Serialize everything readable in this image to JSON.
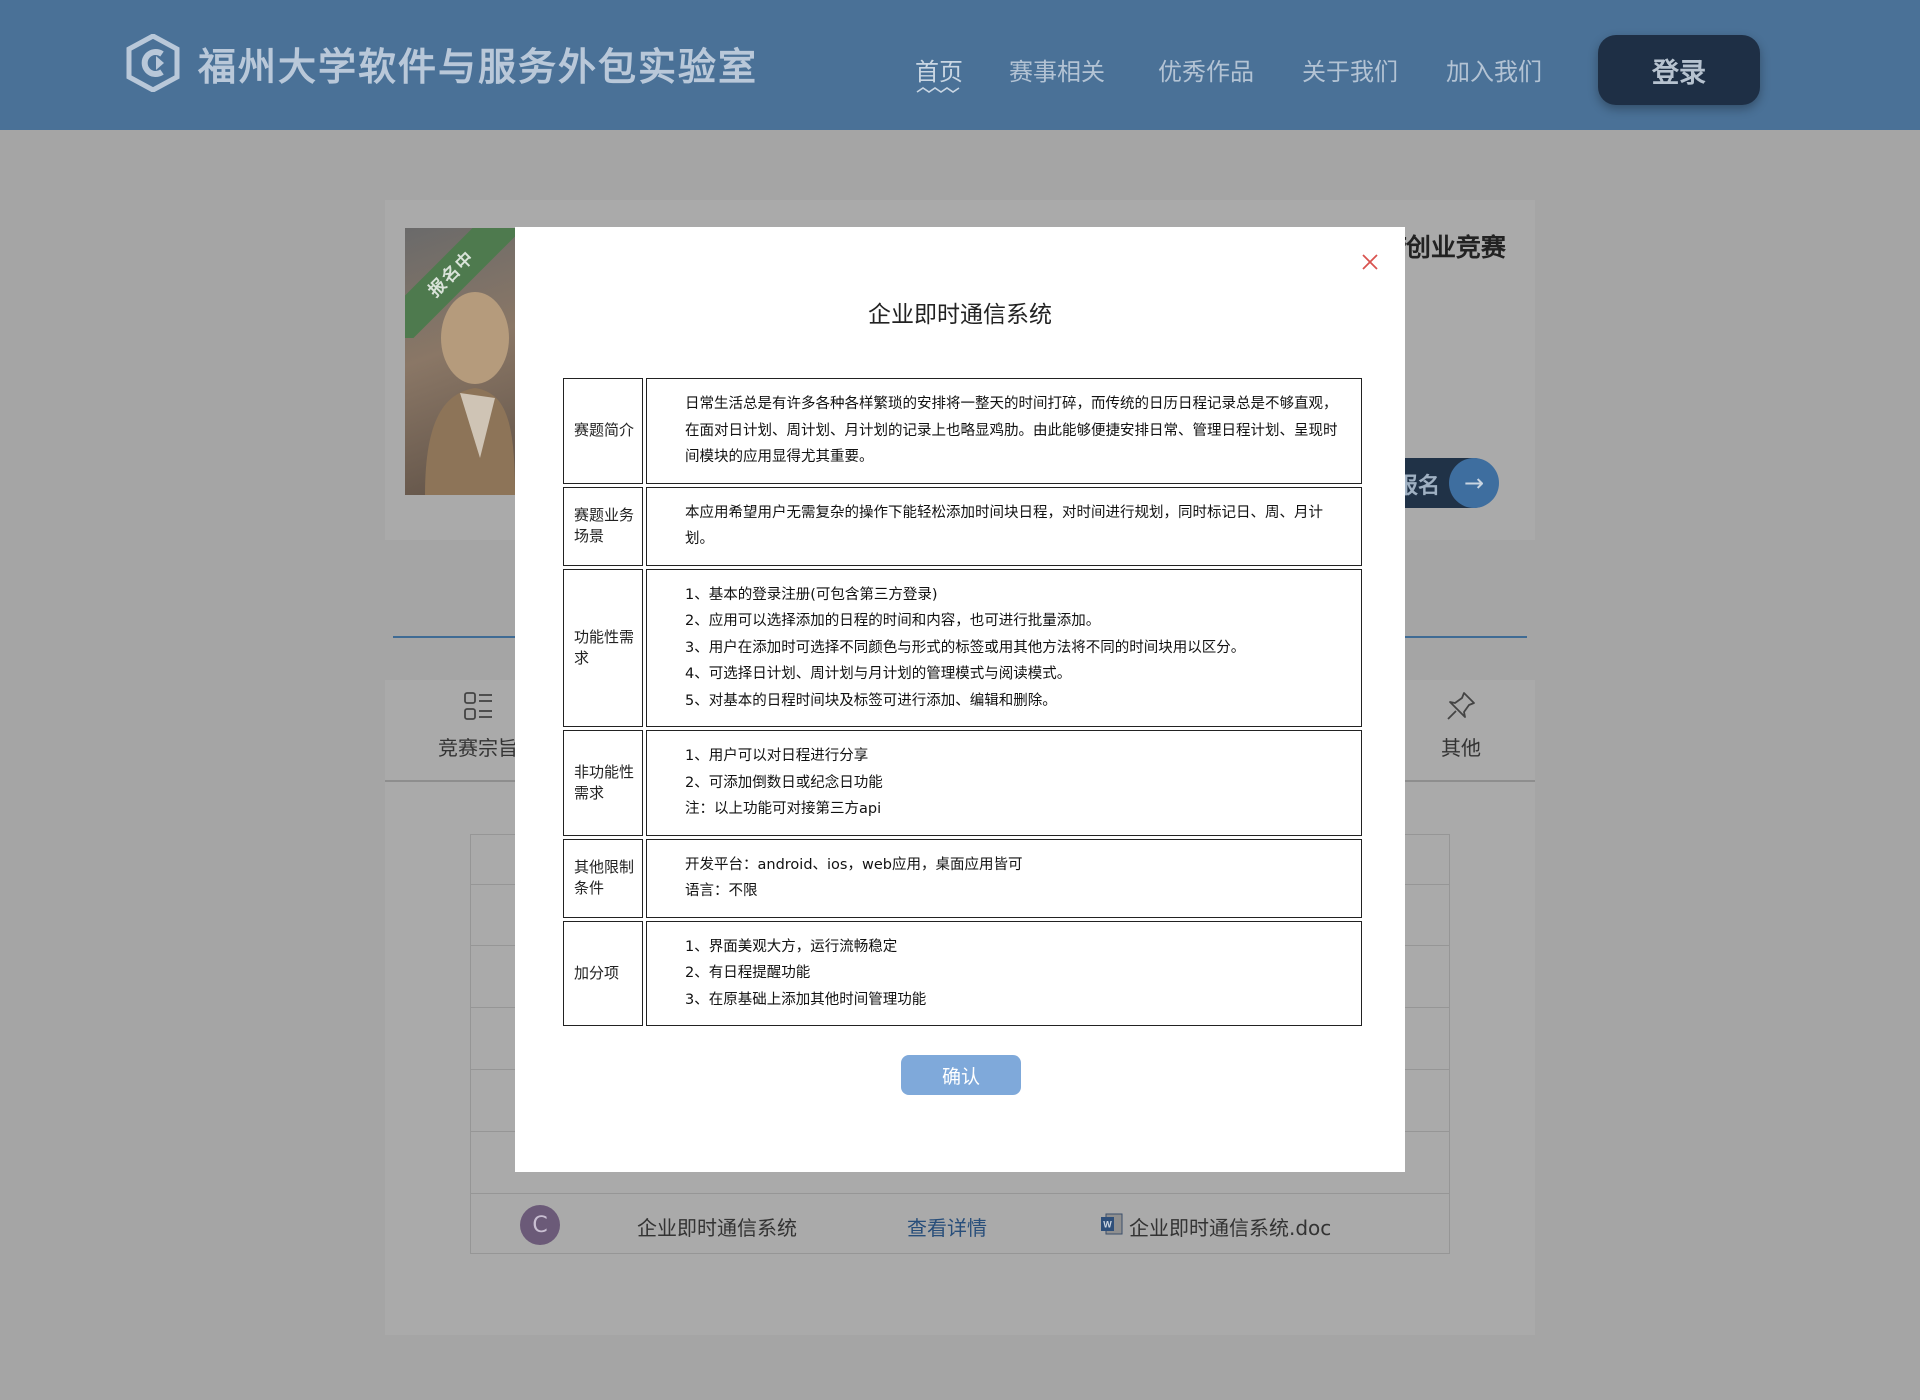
{
  "header": {
    "site_title": "福州大学软件与服务外包实验室",
    "nav": [
      "首页",
      "赛事相关",
      "优秀作品",
      "关于我们",
      "加入我们"
    ],
    "active_nav": "首页",
    "login_label": "登录"
  },
  "background": {
    "ribbon_label": "报名中",
    "contest_name_partial": "f创业竞赛",
    "signup_partial": "报名",
    "tabs": [
      {
        "label": "竞赛宗旨",
        "icon": "list-grid-icon"
      },
      {
        "label": "其他",
        "icon": "pin-icon"
      }
    ],
    "row": {
      "avatar_letter": "C",
      "title": "企业即时通信系统",
      "link": "查看详情",
      "file": "企业即时通信系统.doc"
    }
  },
  "modal": {
    "title": "企业即时通信系统",
    "rows": [
      {
        "label": "赛题简介",
        "lines": [
          "日常生活总是有许多各种各样繁琐的安排将一整天的时间打碎，而传统的日历日程记录总是不够直观，在面对日计划、周计划、月计划的记录上也略显鸡肋。由此能够便捷安排日常、管理日程计划、呈现时间模块的应用显得尤其重要。"
        ]
      },
      {
        "label": "赛题业务场景",
        "lines": [
          "本应用希望用户无需复杂的操作下能轻松添加时间块日程，对时间进行规划，同时标记日、周、月计划。"
        ]
      },
      {
        "label": "功能性需求",
        "lines": [
          "1、基本的登录注册(可包含第三方登录)",
          "2、应用可以选择添加的日程的时间和内容，也可进行批量添加。",
          "3、用户在添加时可选择不同颜色与形式的标签或用其他方法将不同的时间块用以区分。",
          "4、可选择日计划、周计划与月计划的管理模式与阅读模式。",
          "5、对基本的日程时间块及标签可进行添加、编辑和删除。"
        ]
      },
      {
        "label": "非功能性需求",
        "lines": [
          "1、用户可以对日程进行分享",
          "2、可添加倒数日或纪念日功能",
          "注：以上功能可对接第三方api"
        ]
      },
      {
        "label": "其他限制条件",
        "lines": [
          "开发平台：android、ios，web应用，桌面应用皆可",
          "语言：不限"
        ]
      },
      {
        "label": "加分项",
        "lines": [
          "1、界面美观大方，运行流畅稳定",
          "2、有日程提醒功能",
          "3、在原基础上添加其他时间管理功能"
        ]
      }
    ],
    "confirm_label": "确认"
  },
  "colors": {
    "header_bg": "#4a7197",
    "overlay_bg": "#a5a5a5",
    "confirm_bg": "#7fa9da",
    "close_color": "#d9534f",
    "link_color": "#284e7a"
  }
}
